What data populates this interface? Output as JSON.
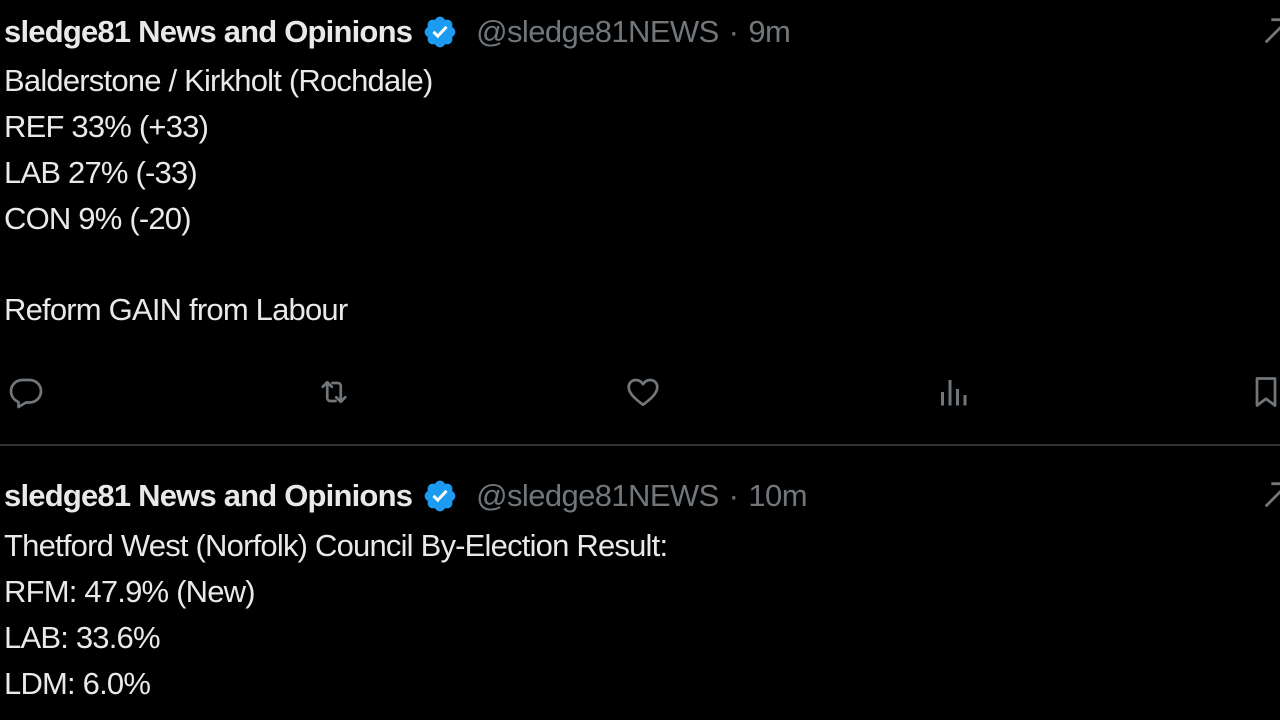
{
  "tweets": [
    {
      "author_name": "sledge81 News and Opinions",
      "handle": "@sledge81NEWS",
      "separator": "·",
      "time": "9m",
      "lines": [
        "Balderstone / Kirkholt (Rochdale)",
        "REF 33% (+33)",
        "LAB 27% (-33)",
        "CON 9% (-20)",
        "",
        "Reform GAIN from Labour"
      ]
    },
    {
      "author_name": "sledge81 News and Opinions",
      "handle": "@sledge81NEWS",
      "separator": "·",
      "time": "10m",
      "lines": [
        "Thetford West (Norfolk) Council By-Election Result:",
        "RFM: 47.9% (New)",
        "LAB: 33.6%",
        "LDM: 6.0%"
      ]
    }
  ],
  "icons": {
    "reply": "reply-icon",
    "repost": "repost-icon",
    "like": "like-icon",
    "views": "views-icon",
    "bookmark": "bookmark-icon",
    "verified": "verified-badge-icon",
    "grok": "grok-icon"
  },
  "colors": {
    "background": "#000000",
    "text": "#e7e9ea",
    "muted": "#71767b",
    "verified": "#1d9bf0",
    "divider": "#2f3336"
  }
}
